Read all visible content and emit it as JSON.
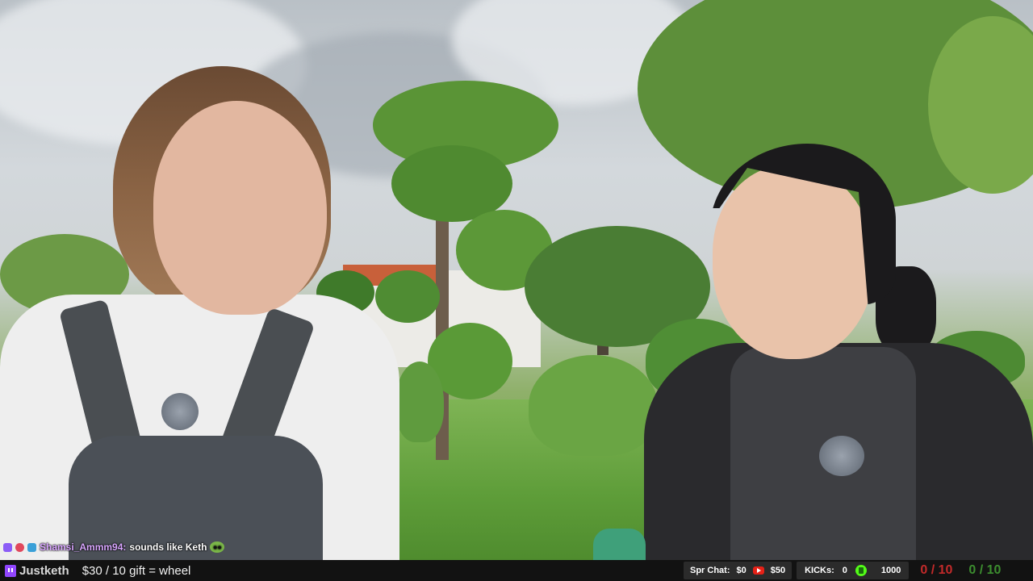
{
  "chat": {
    "username": "Shamsi_Ammm94:",
    "message": "sounds like Keth"
  },
  "bar": {
    "channel": "Justketh",
    "wheel_text": "$30 / 10 gift = wheel",
    "spr_chat_label": "Spr Chat:",
    "spr_chat_value": "$0",
    "youtube_value": "$50",
    "kicks_label": "KICKs:",
    "kicks_value": "0",
    "kick_goal_value": "1000",
    "counter_red": "0 / 10",
    "counter_green": "0 / 10"
  },
  "colors": {
    "bar_bg": "#121212",
    "counter_red": "#c22a2a",
    "counter_green": "#3c8d2f",
    "twitch": "#9146ff",
    "youtube": "#e62117",
    "kick": "#53fc18"
  },
  "icons": [
    "twitch-icon",
    "youtube-icon",
    "kick-icon",
    "chat-badge-icon",
    "frog-emote-icon"
  ]
}
